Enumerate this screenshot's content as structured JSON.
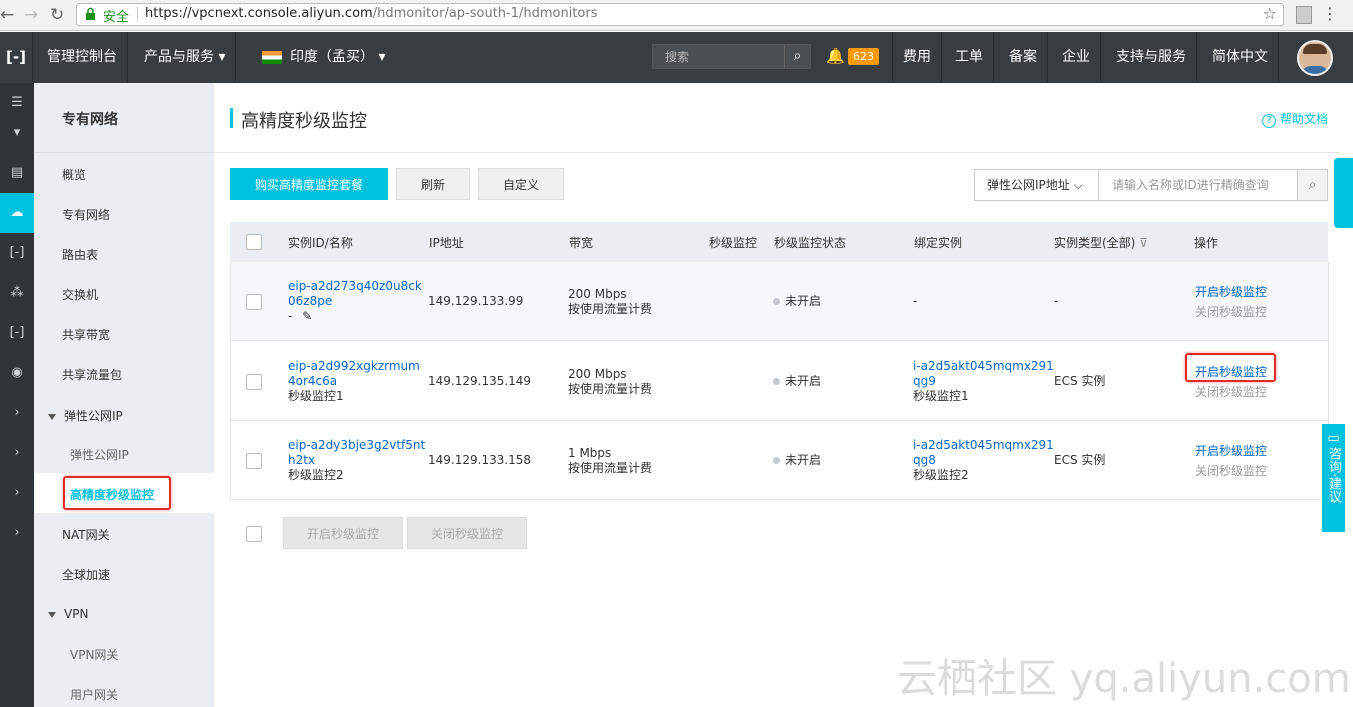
{
  "browser": {
    "security_label": "安全",
    "url_host": "https://vpcnext.console.aliyun.com",
    "url_path": "/hdmonitor/ap-south-1/hdmonitors"
  },
  "topnav": {
    "console": "管理控制台",
    "products": "产品与服务",
    "region": "印度（孟买）",
    "search_placeholder": "搜索",
    "notif_count": "623",
    "links": [
      "费用",
      "工单",
      "备案",
      "企业",
      "支持与服务",
      "简体中文"
    ]
  },
  "sidebar": {
    "title": "专有网络",
    "items": [
      "概览",
      "专有网络",
      "路由表",
      "交换机",
      "共享带宽",
      "共享流量包"
    ],
    "group_eip": "弹性公网IP",
    "eip_sub": [
      "弹性公网IP",
      "高精度秒级监控"
    ],
    "nat": "NAT网关",
    "global": "全球加速",
    "group_vpn": "VPN",
    "vpn_sub": [
      "VPN网关",
      "用户网关"
    ]
  },
  "main": {
    "title": "高精度秒级监控",
    "help": "帮助文档",
    "btn_buy": "购买高精度监控套餐",
    "btn_refresh": "刷新",
    "btn_custom": "自定义",
    "filter_select": "弹性公网IP地址",
    "filter_placeholder": "请输入名称或ID进行精确查询",
    "columns": [
      "实例ID/名称",
      "IP地址",
      "带宽",
      "秒级监控",
      "秒级监控状态",
      "绑定实例",
      "实例类型(全部)",
      "操作"
    ],
    "rows": [
      {
        "id1": "eip-a2d273q40z0u8ck",
        "id2": "06z8pe",
        "name": "-",
        "ip": "149.129.133.99",
        "bw": "200 Mbps",
        "billing": "按使用流量计费",
        "status": "未开启",
        "inst1": "-",
        "inst2": "",
        "inst3": "",
        "type": "-",
        "op_on": "开启秒级监控",
        "op_off": "关闭秒级监控"
      },
      {
        "id1": "eip-a2d992xgkzrmum",
        "id2": "4or4c6a",
        "name": "秒级监控1",
        "ip": "149.129.135.149",
        "bw": "200 Mbps",
        "billing": "按使用流量计费",
        "status": "未开启",
        "inst1": "i-a2d5akt045mqmx291",
        "inst2": "qg9",
        "inst3": "秒级监控1",
        "type": "ECS 实例",
        "op_on": "开启秒级监控",
        "op_off": "关闭秒级监控"
      },
      {
        "id1": "eip-a2dy3bje3g2vtf5nt",
        "id2": "h2tx",
        "name": "秒级监控2",
        "ip": "149.129.133.158",
        "bw": "1 Mbps",
        "billing": "按使用流量计费",
        "status": "未开启",
        "inst1": "i-a2d5akt045mqmx291",
        "inst2": "qg8",
        "inst3": "秒级监控2",
        "type": "ECS 实例",
        "op_on": "开启秒级监控",
        "op_off": "关闭秒级监控"
      }
    ],
    "bulk_on": "开启秒级监控",
    "bulk_off": "关闭秒级监控"
  },
  "consult_label": "咨询·建议",
  "watermark": "云栖社区 yq.aliyun.com",
  "colors": {
    "accent": "#00c1de",
    "topbar": "#373d41",
    "highlight": "#e02b2b"
  }
}
